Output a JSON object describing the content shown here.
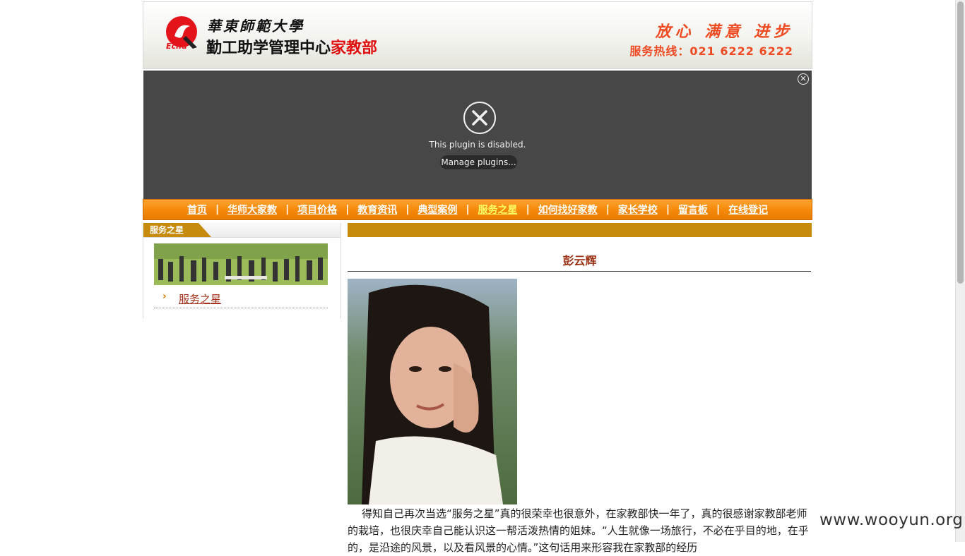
{
  "header": {
    "university": "華東師範大學",
    "department": "勤工助学管理中心",
    "department_sub": "家教部",
    "logo_text": "Ecnu",
    "slogan": "放心 满意 进步",
    "hotline": "服务热线：021 6222 6222"
  },
  "plugin": {
    "message": "This plugin is disabled.",
    "manage_label": "Manage plugins..."
  },
  "nav": {
    "items": [
      {
        "label": "首页"
      },
      {
        "label": "华师大家教"
      },
      {
        "label": "项目价格"
      },
      {
        "label": "教育资讯"
      },
      {
        "label": "典型案例"
      },
      {
        "label": "服务之星",
        "active": true
      },
      {
        "label": "如何找好家教"
      },
      {
        "label": "家长学校"
      },
      {
        "label": "留言板"
      },
      {
        "label": "在线登记"
      }
    ],
    "separator": "|"
  },
  "sidebar": {
    "title": "服务之星",
    "link_label": "服务之星",
    "arrow": "›"
  },
  "content": {
    "name": "彭云辉",
    "article": "得知自己再次当选“服务之星”真的很荣幸也很意外，在家教部快一年了，真的很感谢家教部老师的栽培，也很庆幸自己能认识这一帮活泼热情的姐妹。“人生就像一场旅行，不必在乎目的地，在乎的，是沿途的风景，以及看风景的心情。”这句话用来形容我在家教部的经历"
  },
  "watermark": "www.wooyun.org",
  "colors": {
    "nav_orange": "#f58a0a",
    "nav_active": "#ffff66",
    "accent_gold": "#c68a0c",
    "name_red": "#9c3214",
    "slogan_red": "#ef4b22",
    "plugin_bg": "#474747"
  }
}
